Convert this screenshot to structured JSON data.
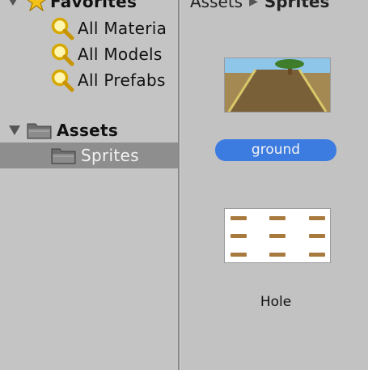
{
  "favorites": {
    "header_label": "Favorites",
    "items": [
      {
        "label": "All Materia",
        "icon": "search-icon"
      },
      {
        "label": "All Models",
        "icon": "search-icon"
      },
      {
        "label": "All Prefabs",
        "icon": "search-icon"
      }
    ]
  },
  "assets": {
    "label": "Assets",
    "icon": "folder-icon",
    "children": [
      {
        "label": "Sprites",
        "icon": "folder-icon",
        "selected": true
      }
    ]
  },
  "breadcrumb": {
    "root": "Assets",
    "separator": "▶",
    "current": "Sprites"
  },
  "grid_items": [
    {
      "name": "ground",
      "selected": true,
      "thumbnail": "ground-sprite-thumbnail"
    },
    {
      "name": "Hole",
      "selected": false,
      "thumbnail": "hole-sprite-thumbnail"
    }
  ],
  "colors": {
    "selection_blue": "#3c7be0",
    "tree_selection": "#8e8e8e",
    "panel_bg": "#c2c2c2"
  }
}
